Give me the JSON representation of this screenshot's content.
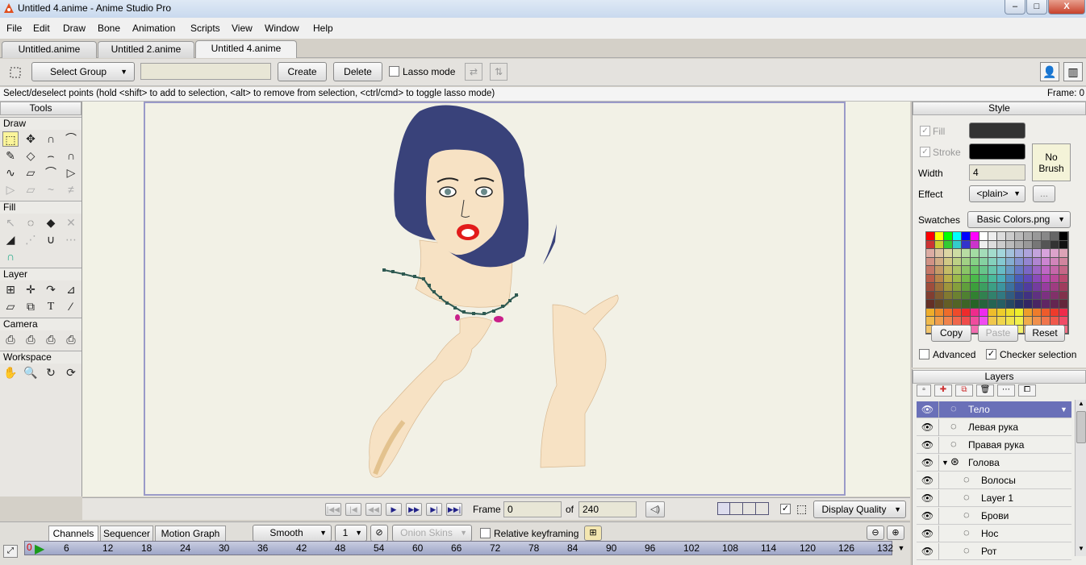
{
  "window": {
    "title": "Untitled 4.anime - Anime Studio Pro",
    "minimize": "–",
    "maximize": "□",
    "close": "X"
  },
  "menu": [
    "File",
    "Edit",
    "Draw",
    "Bone",
    "Animation",
    "Scripts",
    "View",
    "Window",
    "Help"
  ],
  "tabs": [
    "Untitled.anime",
    "Untitled 2.anime",
    "Untitled 4.anime"
  ],
  "toolbar": {
    "select_group": "Select Group",
    "group_name_value": "",
    "create": "Create",
    "delete": "Delete",
    "lasso_mode": "Lasso mode"
  },
  "status": {
    "text": "Select/deselect points (hold <shift> to add to selection, <alt> to remove from selection, <ctrl/cmd> to toggle lasso mode)",
    "frame": "Frame: 0"
  },
  "tools": {
    "title": "Tools",
    "sections": [
      "Draw",
      "Fill",
      "Layer",
      "Camera",
      "Workspace"
    ]
  },
  "style": {
    "title": "Style",
    "fill_label": "Fill",
    "fill_color": "#333333",
    "stroke_label": "Stroke",
    "stroke_color": "#000000",
    "no_brush": "No Brush",
    "width_label": "Width",
    "width_value": "4",
    "effect_label": "Effect",
    "effect_value": "<plain>",
    "effect_more": "...",
    "swatches_label": "Swatches",
    "swatches_value": "Basic Colors.png",
    "copy": "Copy",
    "paste": "Paste",
    "reset": "Reset",
    "advanced": "Advanced",
    "checker_selection": "Checker selection"
  },
  "layers": {
    "title": "Layers",
    "rows": [
      {
        "name": "Тело",
        "selected": true
      },
      {
        "name": "Левая рука"
      },
      {
        "name": "Правая рука"
      },
      {
        "name": "Голова"
      },
      {
        "name": "Волосы"
      },
      {
        "name": "Layer 1"
      },
      {
        "name": "Брови"
      },
      {
        "name": "Нос"
      },
      {
        "name": "Рот"
      }
    ]
  },
  "transport": {
    "frame_label": "Frame",
    "frame_value": "0",
    "of_label": "of",
    "total_frames": "240",
    "display_quality": "Display Quality"
  },
  "timeline": {
    "tabs": [
      "Channels",
      "Sequencer",
      "Motion Graph"
    ],
    "interp": "Smooth",
    "interp_num": "1",
    "onion_skins": "Onion Skins",
    "relative_keyframing": "Relative keyframing",
    "ticks": [
      "6",
      "12",
      "18",
      "24",
      "30",
      "36",
      "42",
      "48",
      "54",
      "60",
      "66",
      "72",
      "78",
      "84",
      "90",
      "96",
      "102",
      "108",
      "114",
      "120",
      "126",
      "132"
    ]
  }
}
